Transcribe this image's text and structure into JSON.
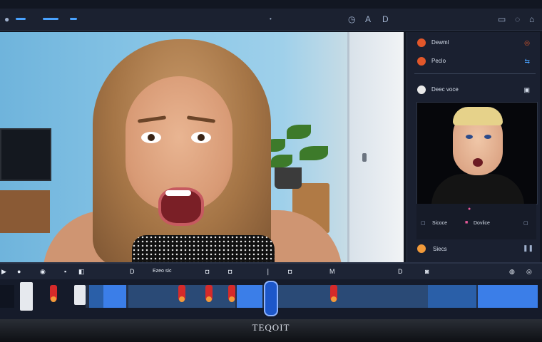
{
  "topbar": {
    "icons": [
      "back-icon",
      "clock-icon",
      "cursor-icon",
      "text-icon",
      "battery-icon",
      "settings-icon",
      "lock-icon"
    ]
  },
  "panel": {
    "items": [
      {
        "label": "Dewml",
        "color": "#e2572a",
        "icon": "record-icon"
      },
      {
        "label": "Peclo",
        "color": "#e2572a",
        "icon": "link-icon"
      },
      {
        "label": "Deec voce",
        "color": "#e9e9e9",
        "icon": "camera-icon"
      }
    ],
    "camera_caption": "Sicoce",
    "camera_tag": "Dovlice",
    "footer_label": "Siecs"
  },
  "timeline": {
    "icons": [
      "play-icon",
      "camera-icon",
      "mic-icon",
      "split-icon",
      "text-icon",
      "add-icon",
      "marker-icon",
      "zoom-icon",
      "settings-icon"
    ],
    "header_label": "Ezeo sic"
  },
  "brand": "TEQOIT",
  "colors": {
    "accent": "#1d57c9",
    "marker": "#d52a2a",
    "track": "#2a5fa8"
  }
}
